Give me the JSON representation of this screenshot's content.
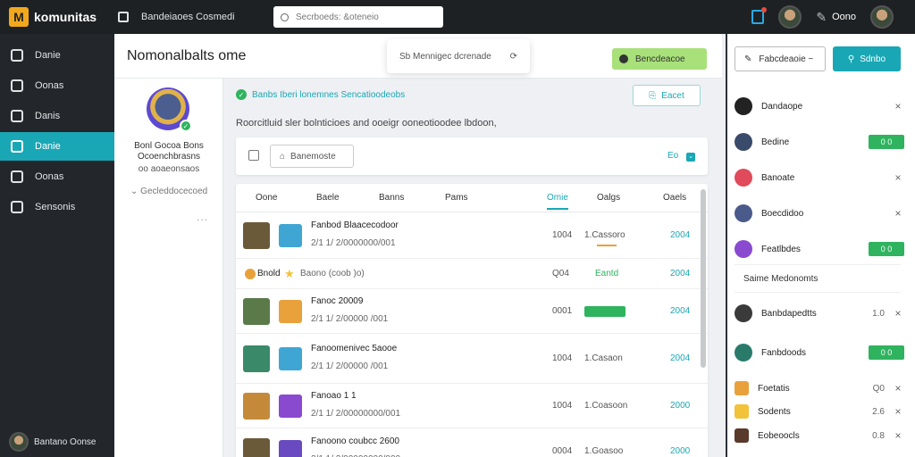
{
  "app": {
    "name": "komunitas",
    "logo_letter": "M"
  },
  "topbar": {
    "breadcrumb": "Bandeiaoes Cosmedi",
    "search_placeholder": "Secrboeds: &oteneio",
    "user_name": "Oono"
  },
  "sidebar": {
    "items": [
      {
        "label": "Danie",
        "icon": "compass-icon",
        "active": false
      },
      {
        "label": "Oonas",
        "icon": "flow-icon",
        "active": false
      },
      {
        "label": "Danis",
        "icon": "board-icon",
        "active": false
      },
      {
        "label": "Danie",
        "icon": "comments-icon",
        "active": true
      },
      {
        "label": "Oonas",
        "icon": "document-icon",
        "active": false
      },
      {
        "label": "Sensonis",
        "icon": "screen-icon",
        "active": false
      }
    ],
    "user_label": "Bantano Oonse"
  },
  "profile": {
    "name_line1": "Bonl Gocoa Bons",
    "name_line2": "Ocoenchbrasns",
    "subtitle": "oo aoaeonsaos",
    "link": "Gecleddocecoed",
    "more": "..."
  },
  "header": {
    "title": "Nomonalbalts ome",
    "popover_text": "Sb Mennigec dcrenade",
    "primary_chip": "Bencdeacoe"
  },
  "content": {
    "alert": "Banbs Iberi lonemnes Sencatioodeobs",
    "outline_button": "Eacet",
    "description": "Roorcitluid sler bolnticioes and ooeigr ooneotioodee lbdoon,",
    "card_button": "Banemoste",
    "card_right": "Eo"
  },
  "table": {
    "headers": [
      "Oone",
      "Baele",
      "Banns",
      "Pams",
      "Omie",
      "Oalgs",
      "Oaels"
    ],
    "active_header": 4,
    "rows": [
      {
        "title": "Fanbod Blaacecodoor",
        "sub": "2/1 1/ 2/0000000/001",
        "col_a": "1004",
        "col_b": "1.Cassoro",
        "col_c": "2004",
        "marker": "orange",
        "thumb1": "#6b5a3a",
        "thumb2": "#3fa6d4"
      },
      {
        "title": "Bnold",
        "sub": "Baono (coob )o)",
        "col_a": "Q04",
        "col_b": "Eantd",
        "col_c": "2004",
        "marker": "compact",
        "thumb1": "#e9a13b",
        "thumb2": "#f2c23a"
      },
      {
        "title": "Fanoc 20009",
        "sub": "2/1 1/ 2/00000 /001",
        "col_a": "0001",
        "col_b": "",
        "col_c": "2004",
        "marker": "badge",
        "thumb1": "#5a7a4a",
        "thumb2": "#e9a13b"
      },
      {
        "title": "Fanoomenivec 5aooe",
        "sub": "2/1 1/ 2/00000 /001",
        "col_a": "1004",
        "col_b": "1.Casaon",
        "col_c": "2004",
        "marker": "none",
        "thumb1": "#3a8a6a",
        "thumb2": "#3fa6d4"
      },
      {
        "title": "Fanoao 1 1",
        "sub": "2/1 1/ 2/00000000/001",
        "col_a": "1004",
        "col_b": "1.Coasoon",
        "col_c": "2000",
        "marker": "none",
        "thumb1": "#c48a3a",
        "thumb2": "#8a4ad0"
      },
      {
        "title": "Fanoono coubcc 2600",
        "sub": "2/1 1/ 2/00000000/000",
        "col_a": "0004",
        "col_b": "1.Goasoo",
        "col_c": "2000",
        "marker": "none",
        "thumb1": "#6b5a3a",
        "thumb2": "#6a4ac0"
      }
    ]
  },
  "rightpanel": {
    "btn_outline": "Fabcdeaoie ~",
    "btn_primary": "Sdnbo",
    "items": [
      {
        "label": "Dandaope",
        "icon_color": "#222",
        "action": "x",
        "pill": ""
      },
      {
        "label": "Bedine",
        "icon_color": "#3a4a6a",
        "action": "pill",
        "pill": "0 0"
      },
      {
        "label": "Banoate",
        "icon_color": "#e04a5a",
        "action": "x",
        "pill": ""
      },
      {
        "label": "Boecdidoo",
        "icon_color": "#4a5a8a",
        "action": "x",
        "pill": ""
      },
      {
        "label": "Featlbdes",
        "icon_color": "#8a4ad0",
        "action": "pill",
        "pill": "0 0"
      }
    ],
    "section_title": "Saime Medonomts",
    "section_items": [
      {
        "label": "Banbdapedtts",
        "icon_color": "#3a3a3a",
        "num": "1.0",
        "action": "x",
        "pill": ""
      },
      {
        "label": "Fanbdoods",
        "icon_color": "#2a7a6a",
        "num": "",
        "action": "pill",
        "pill": "0 0"
      },
      {
        "label": "Foetatis",
        "icon_color": "#e9a13b",
        "num": "Q0",
        "action": "x",
        "pill": ""
      },
      {
        "label": "Sodents",
        "icon_color": "#f2c23a",
        "num": "2.6",
        "action": "x",
        "pill": ""
      },
      {
        "label": "Eobeoocls",
        "icon_color": "#5a3a2a",
        "num": "0.8",
        "action": "x",
        "pill": ""
      }
    ]
  },
  "colors": {
    "accent": "#1aa7b5",
    "success": "#2fb35f",
    "warning": "#e9a13b",
    "dark": "#1e2124"
  }
}
